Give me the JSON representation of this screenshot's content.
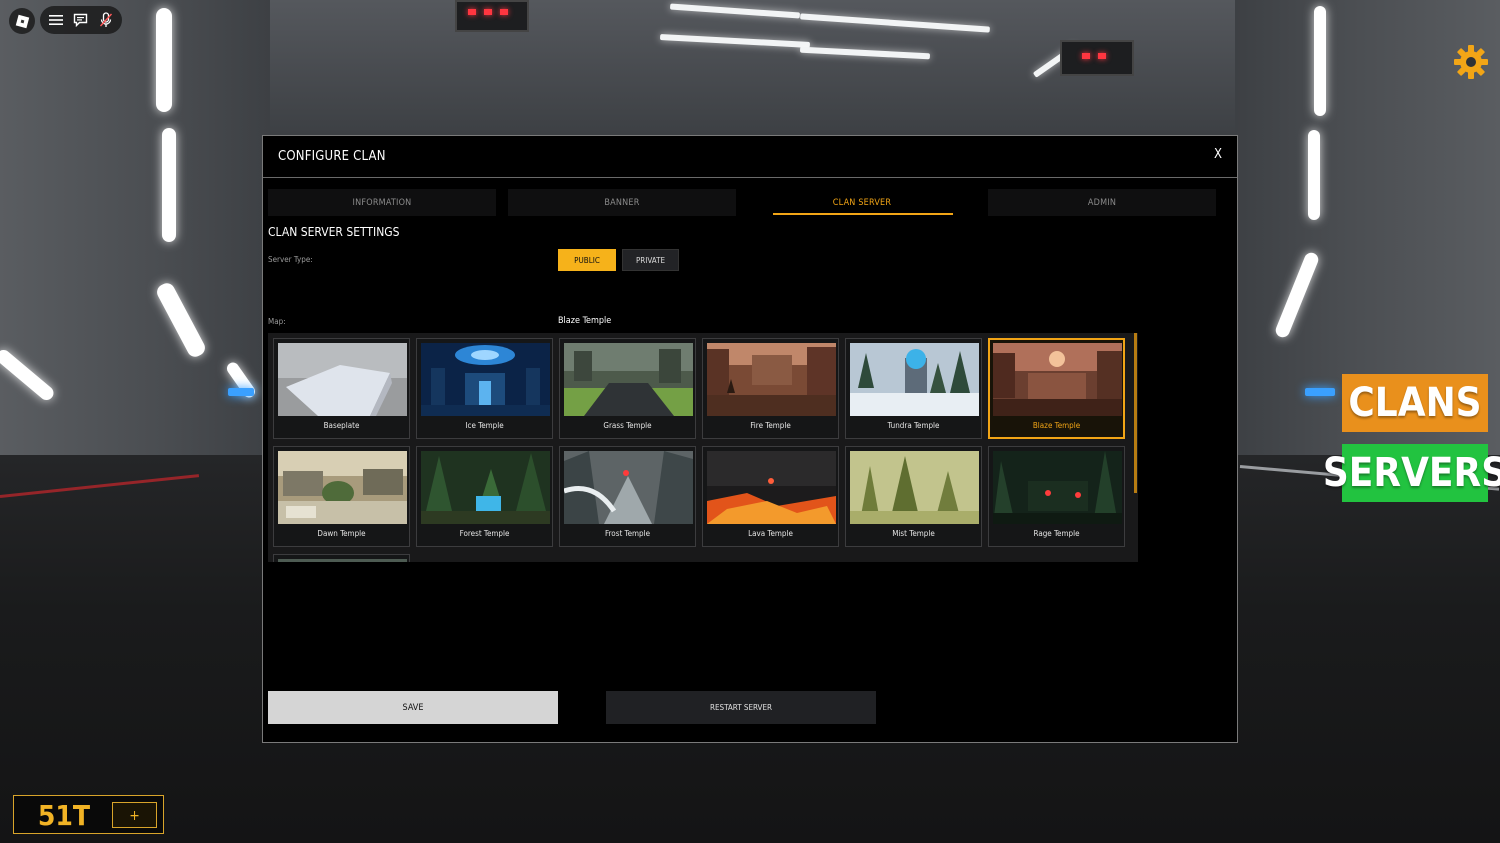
{
  "modal": {
    "title": "CONFIGURE CLAN",
    "close_label": "X",
    "tabs": [
      {
        "label": "INFORMATION",
        "active": false
      },
      {
        "label": "BANNER",
        "active": false
      },
      {
        "label": "CLAN SERVER",
        "active": true
      },
      {
        "label": "ADMIN",
        "active": false
      }
    ],
    "section_title": "CLAN SERVER SETTINGS",
    "server_type_label": "Server Type:",
    "server_type_options": [
      "PUBLIC",
      "PRIVATE"
    ],
    "server_type_selected": "PUBLIC",
    "map_label": "Map:",
    "map_selected": "Blaze Temple",
    "maps": [
      {
        "name": "Baseplate"
      },
      {
        "name": "Ice Temple"
      },
      {
        "name": "Grass Temple"
      },
      {
        "name": "Fire Temple"
      },
      {
        "name": "Tundra Temple"
      },
      {
        "name": "Blaze Temple"
      },
      {
        "name": "Dawn Temple"
      },
      {
        "name": "Forest Temple"
      },
      {
        "name": "Frost Temple"
      },
      {
        "name": "Lava Temple"
      },
      {
        "name": "Mist Temple"
      },
      {
        "name": "Rage Temple"
      }
    ],
    "save_label": "SAVE",
    "restart_label": "RESTART SERVER"
  },
  "side_buttons": {
    "clans": "CLANS",
    "servers": "SERVERS"
  },
  "currency": {
    "amount": "51T",
    "add_label": "+"
  },
  "colors": {
    "accent": "#f2a516",
    "clans": "#e9901c",
    "servers": "#22c340"
  }
}
